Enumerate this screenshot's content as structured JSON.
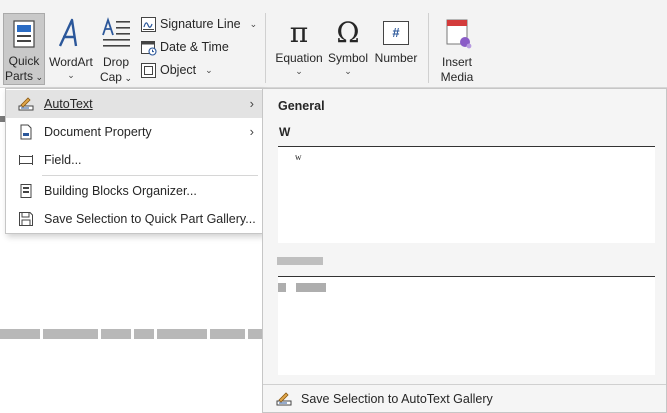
{
  "ribbon": {
    "quick_parts": {
      "line1": "Quick",
      "line2": "Parts",
      "icon": "quick-parts-icon"
    },
    "wordart": {
      "label": "WordArt",
      "icon": "wordart-icon"
    },
    "drop_cap": {
      "line1": "Drop",
      "line2": "Cap",
      "icon": "drop-cap-icon"
    },
    "signature_line": {
      "label": "Signature Line",
      "icon": "signature-line-icon"
    },
    "date_time": {
      "label": "Date & Time",
      "icon": "calendar-icon"
    },
    "object": {
      "label": "Object",
      "icon": "object-icon"
    },
    "equation": {
      "label": "Equation",
      "glyph": "π"
    },
    "symbol": {
      "label": "Symbol",
      "glyph": "Ω"
    },
    "number": {
      "label": "Number",
      "glyph": "#"
    },
    "insert_media": {
      "line1": "Insert",
      "line2": "Media",
      "icon": "insert-media-icon"
    }
  },
  "menu": {
    "items": [
      {
        "label": "AutoText",
        "icon": "autotext-icon",
        "submenu": true
      },
      {
        "label": "Document Property",
        "icon": "document-property-icon",
        "submenu": true
      },
      {
        "label": "Field...",
        "icon": "field-icon",
        "submenu": false
      },
      {
        "label": "Building Blocks Organizer...",
        "icon": "building-blocks-icon",
        "submenu": false
      },
      {
        "label": "Save Selection to Quick Part Gallery...",
        "icon": "save-icon",
        "submenu": false
      }
    ]
  },
  "gallery": {
    "heading": "General",
    "entry1_name": "W",
    "entry1_text": "w",
    "footer": "Save Selection to AutoText Gallery"
  },
  "colors": {
    "ribbon_bg": "#f3f3f3",
    "selected_button": "#c9c9c9",
    "hover_item": "#e3e3e3",
    "accent_blue": "#2b579a"
  }
}
